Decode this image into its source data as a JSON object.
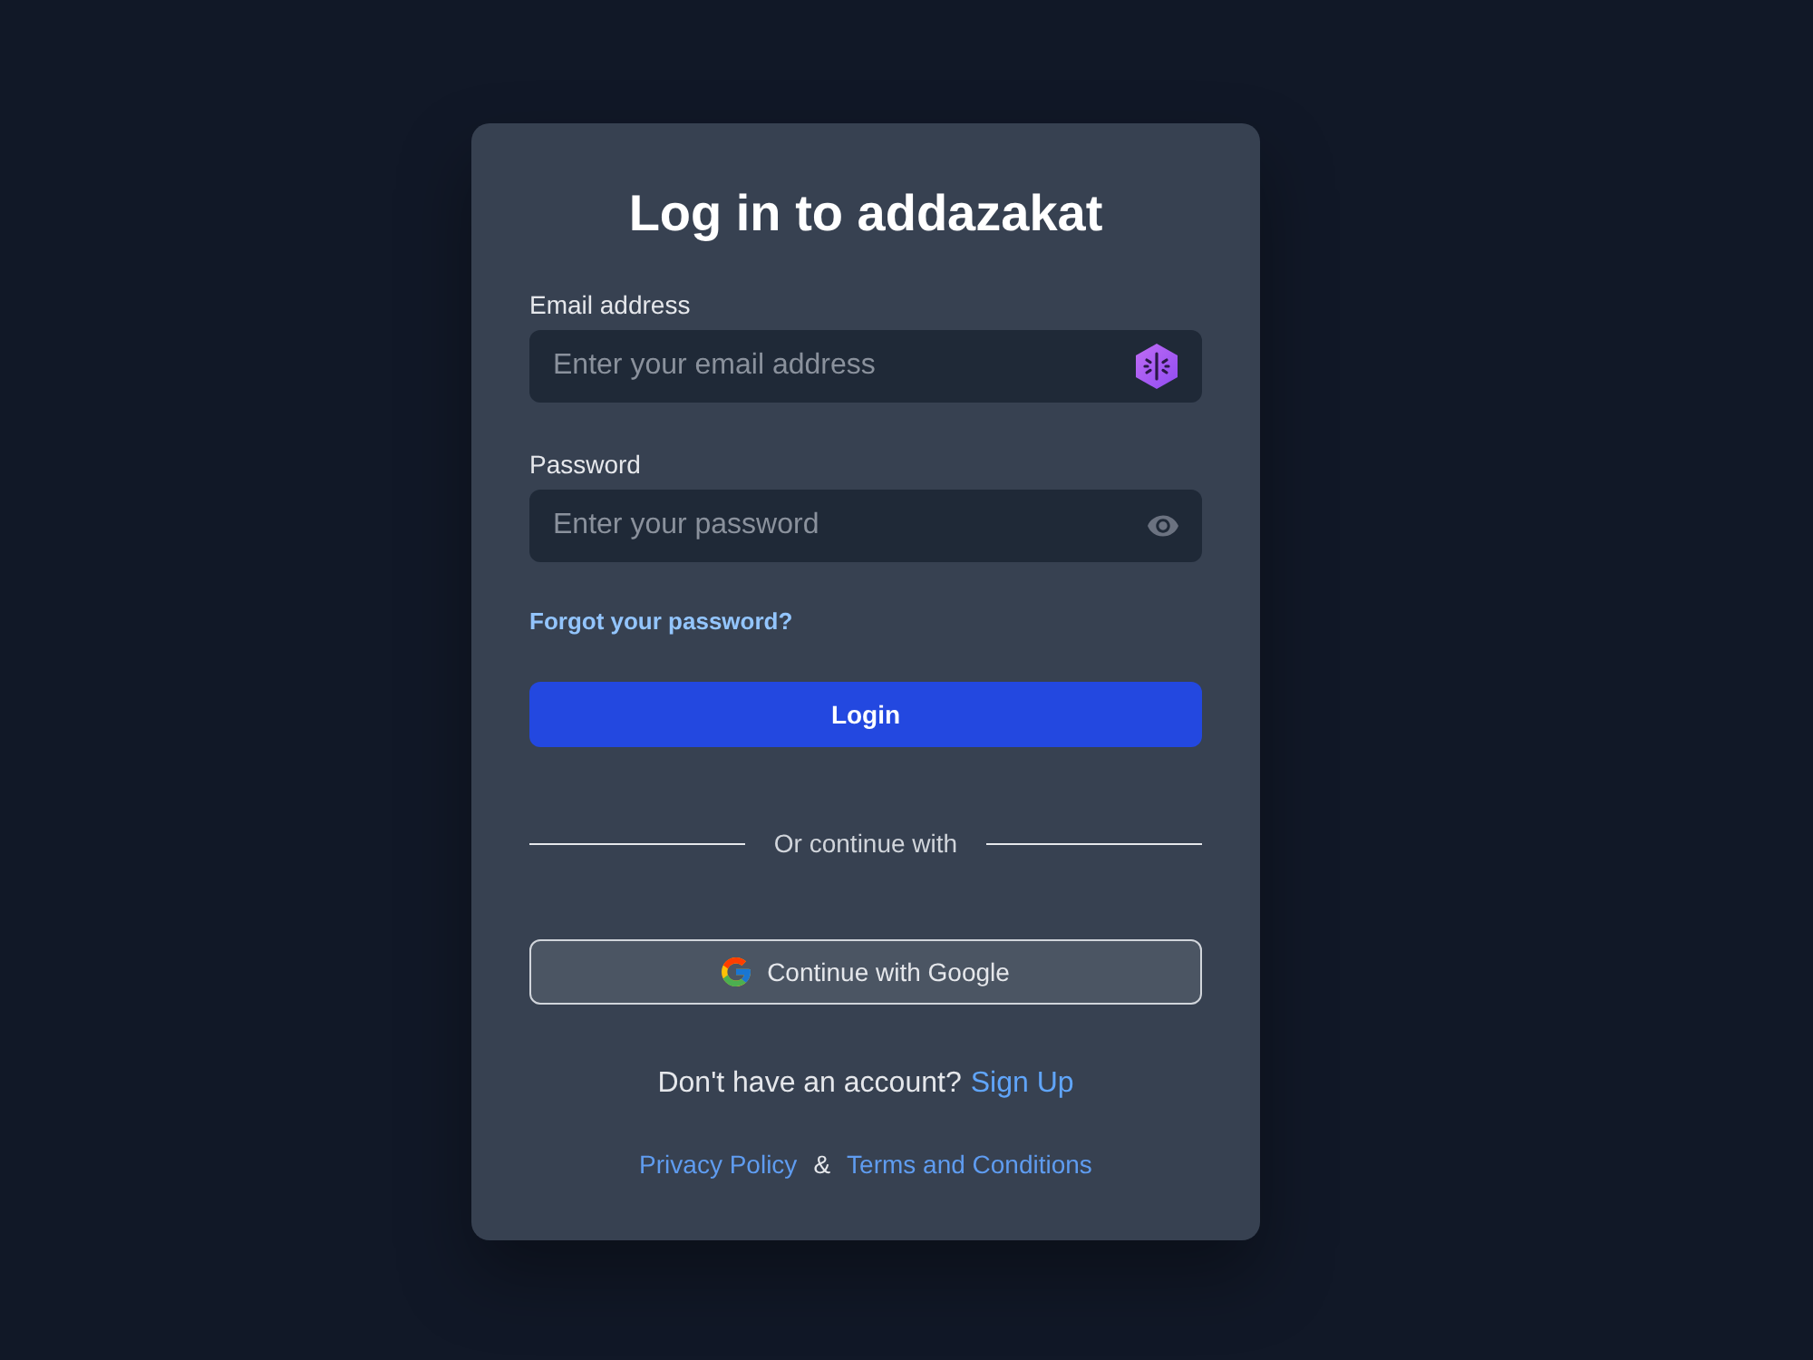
{
  "title": "Log in to addazakat",
  "fields": [
    {
      "kind": "email",
      "label": "Email address",
      "placeholder": "Enter your email address"
    },
    {
      "kind": "password",
      "label": "Password",
      "placeholder": "Enter your password"
    }
  ],
  "forgot_link": "Forgot your password?",
  "login_button": "Login",
  "divider": "Or continue with",
  "google_button": "Continue with Google",
  "signup": {
    "prompt": "Don't have an account?",
    "link": "Sign Up"
  },
  "footer": {
    "links": [
      "Privacy Policy",
      "Terms and Conditions"
    ],
    "separator": "&"
  }
}
